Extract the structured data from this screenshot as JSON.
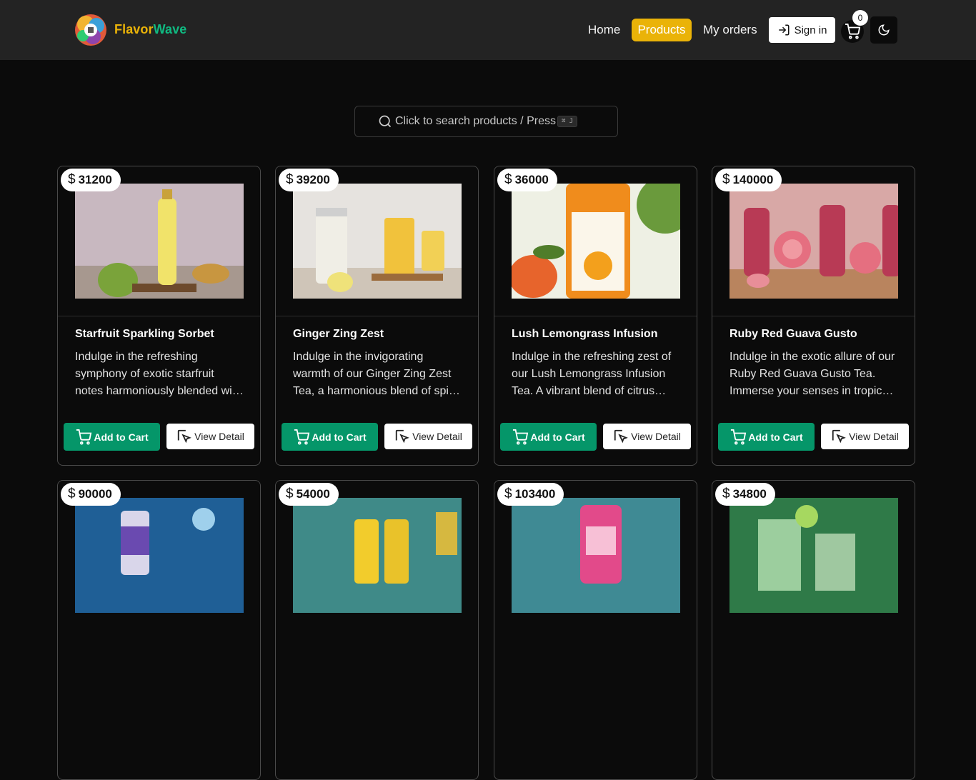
{
  "brand": {
    "part1": "Flavor",
    "part2": "Wave"
  },
  "nav": {
    "home": "Home",
    "products": "Products",
    "orders": "My orders",
    "signin": "Sign in",
    "cart_count": "0"
  },
  "search": {
    "placeholder": "Click to search products / Press",
    "shortcut": "⌘ J"
  },
  "currency_symbol": "$",
  "buttons": {
    "add_to_cart": "Add to Cart",
    "view_detail": "View Detail"
  },
  "products": [
    {
      "price": "31200",
      "title": "Starfruit Sparkling Sorbet",
      "description": "Indulge in the refreshing symphony of exotic starfruit notes harmoniously blended with a sparkling twist"
    },
    {
      "price": "39200",
      "title": "Ginger Zing Zest",
      "description": "Indulge in the invigorating warmth of our Ginger Zing Zest Tea, a harmonious blend of spice and citrus"
    },
    {
      "price": "36000",
      "title": "Lush Lemongrass Infusion",
      "description": "Indulge in the refreshing zest of our Lush Lemongrass Infusion Tea. A vibrant blend of citrus notes"
    },
    {
      "price": "140000",
      "title": "Ruby Red Guava Gusto",
      "description": "Indulge in the exotic allure of our Ruby Red Guava Gusto Tea. Immerse your senses in tropical bliss"
    },
    {
      "price": "90000",
      "title": "",
      "description": ""
    },
    {
      "price": "54000",
      "title": "",
      "description": ""
    },
    {
      "price": "103400",
      "title": "",
      "description": ""
    },
    {
      "price": "34800",
      "title": "",
      "description": ""
    }
  ],
  "colors": {
    "accent_yellow": "#eab308",
    "accent_green": "#059669",
    "background": "#0b0b0b",
    "navbar": "#232323"
  }
}
